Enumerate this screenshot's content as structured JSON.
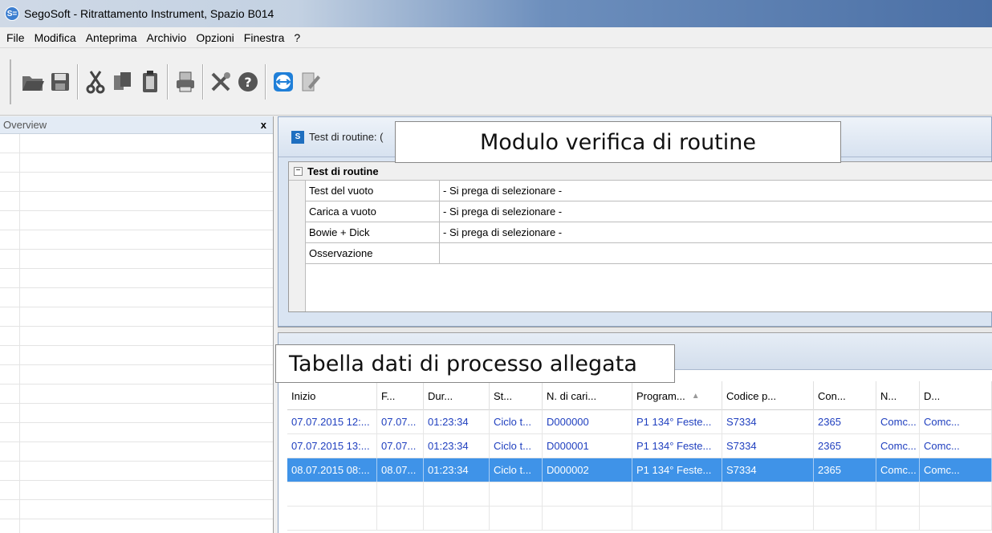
{
  "window": {
    "title": "SegoSoft - Ritrattamento Instrument, Spazio B014",
    "logo": "S="
  },
  "menu": [
    "File",
    "Modifica",
    "Anteprima",
    "Archivio",
    "Opzioni",
    "Finestra",
    "?"
  ],
  "toolbar": {
    "icons": [
      "folder-open-icon",
      "save-icon",
      "cut-icon",
      "copy-icon",
      "paste-icon",
      "print-icon",
      "tools-icon",
      "help-icon",
      "teamviewer-icon",
      "edit-document-icon"
    ]
  },
  "overview": {
    "title": "Overview",
    "close": "x"
  },
  "top_panel": {
    "tab_label": "Test di routine: (",
    "category": "Test di routine",
    "category_toggle": "−",
    "properties": [
      {
        "name": "Test del vuoto",
        "value": "- Si prega di selezionare -"
      },
      {
        "name": "Carica a vuoto",
        "value": "- Si prega di selezionare -"
      },
      {
        "name": "Bowie + Dick",
        "value": "- Si prega di selezionare -"
      },
      {
        "name": "Osservazione",
        "value": ""
      }
    ]
  },
  "table": {
    "columns": [
      "Inizio",
      "F...",
      "Dur...",
      "St...",
      "N. di cari...",
      "Program...",
      "Codice p...",
      "Con...",
      "N...",
      "D..."
    ],
    "sort_indicator": "▲",
    "rows": [
      [
        "07.07.2015 12:...",
        "07.07...",
        "01:23:34",
        "Ciclo t...",
        "D000000",
        "P1 134° Feste...",
        "S7334",
        "2365",
        "Comc...",
        "Comc..."
      ],
      [
        "07.07.2015 13:...",
        "07.07...",
        "01:23:34",
        "Ciclo t...",
        "D000001",
        "P1 134° Feste...",
        "S7334",
        "2365",
        "Comc...",
        "Comc..."
      ],
      [
        "08.07.2015 08:...",
        "08.07...",
        "01:23:34",
        "Ciclo t...",
        "D000002",
        "P1 134° Feste...",
        "S7334",
        "2365",
        "Comc...",
        "Comc..."
      ]
    ],
    "selected_row": 2
  },
  "callouts": {
    "top": "Modulo verifica di routine",
    "bottom": "Tabella dati di processo allegata"
  },
  "colors": {
    "selection": "#3f93e8",
    "row_text": "#1f3fbf",
    "panel_bg": "#d9e4f2"
  }
}
